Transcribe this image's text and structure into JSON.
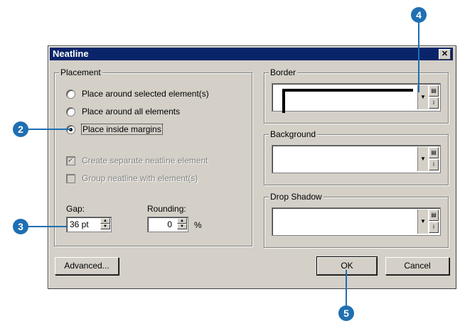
{
  "dialog": {
    "title": "Neatline",
    "close_label": "✕"
  },
  "placement": {
    "label": "Placement",
    "radios": [
      {
        "label": "Place around selected element(s)",
        "selected": false
      },
      {
        "label": "Place around all elements",
        "selected": false
      },
      {
        "label": "Place inside margins",
        "selected": true
      }
    ],
    "checkboxes": [
      {
        "label": "Create separate neatline element",
        "checked": true,
        "enabled": false
      },
      {
        "label": "Group neatline with element(s)",
        "checked": false,
        "enabled": false
      }
    ],
    "gap": {
      "label": "Gap:",
      "value": "36 pt"
    },
    "rounding": {
      "label": "Rounding:",
      "value": "0",
      "unit": "%"
    }
  },
  "border": {
    "label": "Border"
  },
  "background": {
    "label": "Background"
  },
  "drop_shadow": {
    "label": "Drop Shadow"
  },
  "buttons": {
    "advanced": "Advanced...",
    "ok": "OK",
    "cancel": "Cancel"
  },
  "callouts": {
    "c2": "2",
    "c3": "3",
    "c4": "4",
    "c5": "5"
  },
  "colors": {
    "callout": "#1f6fb2",
    "titlebar": "#0a246a",
    "dialog_bg": "#d4d0c8"
  }
}
